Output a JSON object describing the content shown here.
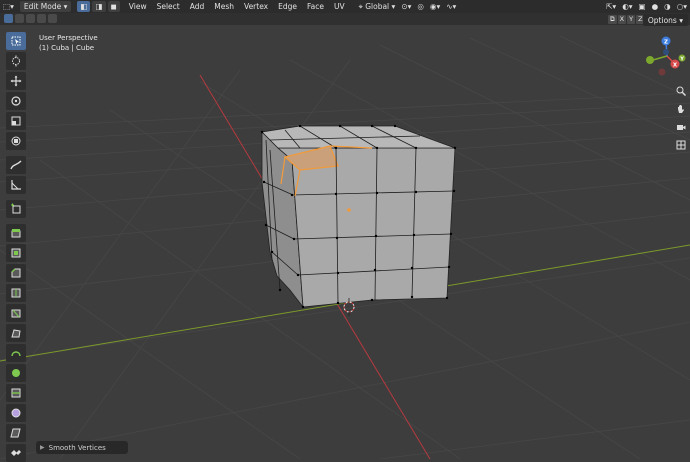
{
  "header": {
    "mode": "Edit Mode",
    "menus": [
      "View",
      "Select",
      "Add",
      "Mesh",
      "Vertex",
      "Edge",
      "Face",
      "UV"
    ],
    "orientation": "Global"
  },
  "gizmo_axes": {
    "x": "X",
    "y": "Y",
    "z": "Z"
  },
  "axis_buttons": [
    "X",
    "Y",
    "Z"
  ],
  "viewport": {
    "view_name": "User Perspective",
    "object_info": "(1) Cuba | Cube"
  },
  "options_label": "Options",
  "last_operator": "Smooth Vertices",
  "colors": {
    "background": "#3d3d3d",
    "header": "#2c2c2c",
    "accent": "#4a6c9b",
    "selection": "#f39a3a",
    "x_axis": "#b53a3f",
    "y_axis": "#7c9a2a"
  },
  "toolbar": [
    "select-box-icon",
    "cursor-icon",
    "move-icon",
    "rotate-icon",
    "scale-icon",
    "transform-icon",
    "annotate-icon",
    "measure-icon",
    "add-cube-icon",
    "extrude-icon",
    "inset-icon",
    "bevel-icon",
    "loop-cut-icon",
    "knife-icon",
    "poly-build-icon",
    "spin-icon",
    "smooth-icon",
    "edge-slide-icon",
    "shrink-fatten-icon",
    "shear-icon",
    "rip-icon"
  ]
}
